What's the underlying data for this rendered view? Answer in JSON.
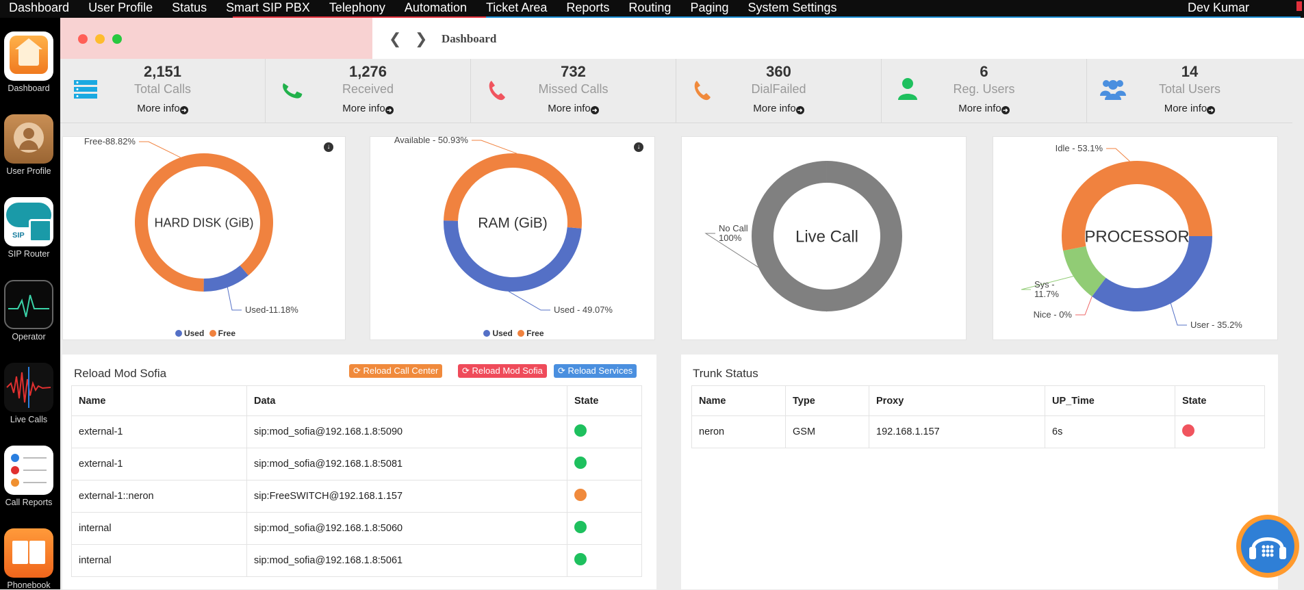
{
  "topbar": {
    "menu": [
      "Dashboard",
      "User Profile",
      "Status",
      "Smart SIP PBX",
      "Telephony",
      "Automation",
      "Ticket Area",
      "Reports",
      "Routing",
      "Paging",
      "System Settings"
    ],
    "user": "Dev Kumar"
  },
  "dock": [
    {
      "label": "Dashboard",
      "icon": "home-icon"
    },
    {
      "label": "User Profile",
      "icon": "user-profile-icon"
    },
    {
      "label": "SIP Router",
      "icon": "sip-router-icon",
      "badge": "SIP"
    },
    {
      "label": "Operator",
      "icon": "operator-icon"
    },
    {
      "label": "Live Calls",
      "icon": "live-calls-icon"
    },
    {
      "label": "Call Reports",
      "icon": "call-reports-icon"
    },
    {
      "label": "Phonebook",
      "icon": "phonebook-icon"
    }
  ],
  "breadcrumb": "Dashboard",
  "stats": [
    {
      "value": "2,151",
      "label": "Total Calls",
      "more": "More info",
      "icon": "server-icon",
      "color": "#1aa9e1"
    },
    {
      "value": "1,276",
      "label": "Received",
      "more": "More info",
      "icon": "phone-received-icon",
      "color": "#21b14b"
    },
    {
      "value": "732",
      "label": "Missed Calls",
      "more": "More info",
      "icon": "phone-missed-icon",
      "color": "#f0545e"
    },
    {
      "value": "360",
      "label": "DialFailed",
      "more": "More info",
      "icon": "phone-failed-icon",
      "color": "#f08a3c"
    },
    {
      "value": "6",
      "label": "Reg. Users",
      "more": "More info",
      "icon": "user-icon",
      "color": "#1ec05e"
    },
    {
      "value": "14",
      "label": "Total Users",
      "more": "More info",
      "icon": "users-icon",
      "color": "#4a8fdf"
    }
  ],
  "chart_data": [
    {
      "type": "pie",
      "title": "HARD DISK (GiB)",
      "labels": [
        "Used",
        "Free"
      ],
      "values": [
        11.18,
        88.82
      ],
      "slice_labels": [
        "Used-11.18%",
        "Free-88.82%"
      ],
      "colors": [
        "#5470c6",
        "#f0823f"
      ],
      "legend": [
        "Used",
        "Free"
      ],
      "legend_position": "bottom"
    },
    {
      "type": "pie",
      "title": "RAM (GiB)",
      "labels": [
        "Used",
        "Available"
      ],
      "values": [
        49.07,
        50.93
      ],
      "slice_labels": [
        "Used - 49.07%",
        "Available - 50.93%"
      ],
      "colors": [
        "#5470c6",
        "#f0823f"
      ],
      "legend": [
        "Used",
        "Free"
      ],
      "legend_position": "bottom"
    },
    {
      "type": "pie",
      "title": "Live Call",
      "labels": [
        "No Call"
      ],
      "values": [
        100
      ],
      "slice_labels": [
        "No Call\n100%"
      ],
      "colors": [
        "#808080"
      ]
    },
    {
      "type": "pie",
      "title": "PROCESSOR",
      "labels": [
        "User",
        "Nice",
        "Sys",
        "Idle"
      ],
      "values": [
        35.2,
        0,
        11.7,
        53.1
      ],
      "slice_labels": [
        "User - 35.2%",
        "Nice - 0%",
        "Sys -\n11.7%",
        "Idle - 53.1%"
      ],
      "colors": [
        "#5470c6",
        "#ee6666",
        "#91cc75",
        "#f0823f"
      ]
    }
  ],
  "reload": {
    "title": "Reload Mod Sofia",
    "buttons": [
      "Reload Call Center",
      "Reload Mod Sofia",
      "Reload Services"
    ],
    "headers": [
      "Name",
      "Data",
      "State"
    ],
    "rows": [
      {
        "name": "external-1",
        "data": "sip:mod_sofia@192.168.1.8:5090",
        "state": "#1ec05e"
      },
      {
        "name": "external-1",
        "data": "sip:mod_sofia@192.168.1.8:5081",
        "state": "#1ec05e"
      },
      {
        "name": "external-1::neron",
        "data": "sip:FreeSWITCH@192.168.1.157",
        "state": "#f08a3c"
      },
      {
        "name": "internal",
        "data": "sip:mod_sofia@192.168.1.8:5060",
        "state": "#1ec05e"
      },
      {
        "name": "internal",
        "data": "sip:mod_sofia@192.168.1.8:5061",
        "state": "#1ec05e"
      }
    ]
  },
  "trunk": {
    "title": "Trunk Status",
    "headers": [
      "Name",
      "Type",
      "Proxy",
      "UP_Time",
      "State"
    ],
    "rows": [
      {
        "name": "neron",
        "type": "GSM",
        "proxy": "192.168.1.157",
        "uptime": "6s",
        "state": "#f0545e"
      }
    ]
  }
}
